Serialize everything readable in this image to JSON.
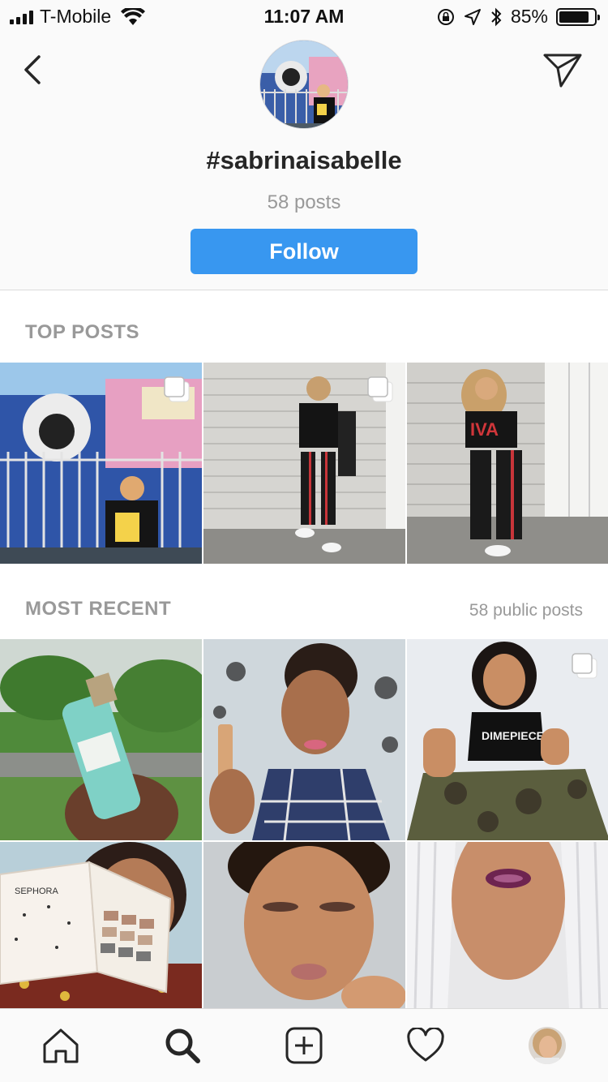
{
  "status_bar": {
    "carrier": "T-Mobile",
    "time": "11:07 AM",
    "battery_percent": "85%",
    "battery_level": 0.85,
    "icons": [
      "signal-icon",
      "wifi-icon",
      "orientation-lock-icon",
      "location-icon",
      "bluetooth-icon",
      "battery-icon"
    ]
  },
  "header": {
    "back_icon": "chevron-left-icon",
    "send_icon": "paper-plane-icon",
    "hashtag": "#sabrinaisabelle",
    "post_count": "58 posts",
    "follow_label": "Follow"
  },
  "top_posts": {
    "label": "TOP POSTS",
    "items": [
      {
        "id": "top-1",
        "multi": true
      },
      {
        "id": "top-2",
        "multi": true
      },
      {
        "id": "top-3",
        "multi": false
      }
    ]
  },
  "most_recent": {
    "label": "MOST RECENT",
    "count_label": "58 public posts",
    "items": [
      {
        "id": "recent-1",
        "multi": false
      },
      {
        "id": "recent-2",
        "multi": false
      },
      {
        "id": "recent-3",
        "multi": true
      },
      {
        "id": "recent-4",
        "multi": false
      },
      {
        "id": "recent-5",
        "multi": false
      },
      {
        "id": "recent-6",
        "multi": false
      }
    ]
  },
  "tab_bar": {
    "tabs": [
      "home-icon",
      "search-icon",
      "new-post-icon",
      "activity-heart-icon",
      "profile-avatar"
    ]
  },
  "colors": {
    "accent": "#3897f0",
    "muted_text": "#999999",
    "primary_text": "#262626"
  }
}
